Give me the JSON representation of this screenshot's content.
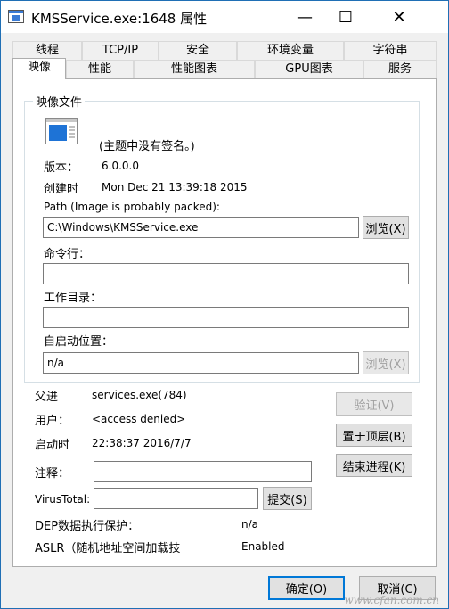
{
  "window": {
    "title": "KMSService.exe:1648 属性"
  },
  "caption": {
    "minimize": "—",
    "maximize": "☐",
    "close": "✕"
  },
  "tabs_row1": [
    "线程",
    "TCP/IP",
    "安全",
    "环境变量",
    "字符串"
  ],
  "tabs_row2": [
    "映像",
    "性能",
    "性能图表",
    "GPU图表",
    "服务"
  ],
  "image_file": {
    "group_title": "映像文件",
    "signature": "(主题中没有签名。)",
    "version_label": "版本：",
    "version_value": "6.0.0.0",
    "created_label": "创建时",
    "created_value": "Mon Dec 21 13:39:18 2015",
    "path_label": "Path (Image is probably packed):",
    "path_value": "C:\\Windows\\KMSService.exe",
    "browse_label": "浏览(X)",
    "cmdline_label": "命令行：",
    "cmdline_value": "",
    "workdir_label": "工作目录：",
    "workdir_value": "",
    "autostart_label": "自启动位置：",
    "autostart_value": "n/a",
    "browse2_label": "浏览(X)"
  },
  "info": {
    "parent_label": "父进",
    "parent_value": "services.exe(784)",
    "user_label": "用户：",
    "user_value": "<access denied>",
    "start_label": "启动时",
    "start_value": "22:38:37   2016/7/7",
    "comment_label": "注释：",
    "comment_value": "",
    "virustotal_label": "VirusTotal:",
    "virustotal_value": "",
    "submit_label": "提交(S)",
    "dep_label": "DEP数据执行保护：",
    "dep_value": "n/a",
    "aslr_label": "ASLR（随机地址空间加载技",
    "aslr_value": "Enabled"
  },
  "side_buttons": {
    "verify": "验证(V)",
    "bring_to_front": "置于顶层(B)",
    "kill": "结束进程(K)"
  },
  "footer": {
    "ok": "确定(O)",
    "cancel": "取消(C)"
  },
  "watermark": "www.cfan.com.cn"
}
